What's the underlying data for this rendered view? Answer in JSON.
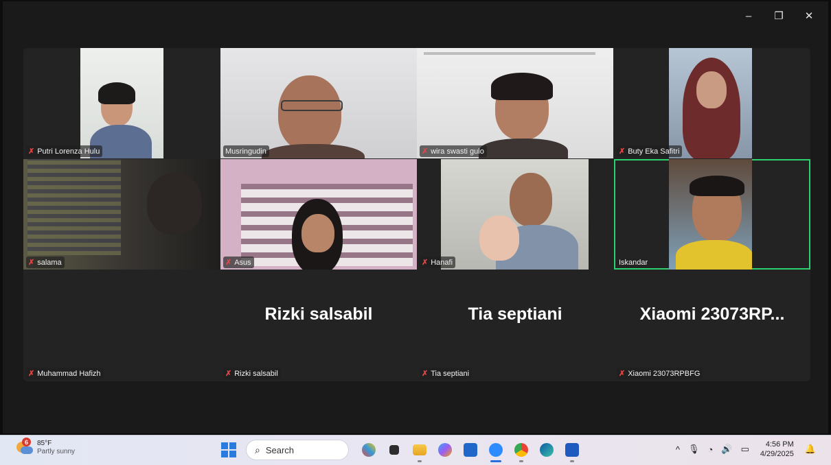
{
  "window": {
    "minimize": "–",
    "restore": "❐",
    "close": "✕"
  },
  "participants": [
    {
      "name": "Putri Lorenza Hulu",
      "muted": true
    },
    {
      "name": "Musringudin",
      "muted": false
    },
    {
      "name": "wira swasti gulo",
      "muted": true
    },
    {
      "name": "Buty Eka Safitri",
      "muted": true
    },
    {
      "name": "salama",
      "muted": true
    },
    {
      "name": "Asus",
      "muted": true
    },
    {
      "name": "Hanafi",
      "muted": true
    },
    {
      "name": "Iskandar",
      "muted": false,
      "active_speaker": true
    },
    {
      "name": "Muhammad Hafizh",
      "muted": true
    },
    {
      "name": "Rizki salsabil",
      "muted": true,
      "big": "Rizki salsabil"
    },
    {
      "name": "Tia septiani",
      "muted": true,
      "big": "Tia septiani"
    },
    {
      "name": "Xiaomi 23073RPBFG",
      "muted": true,
      "big": "Xiaomi  23073RP..."
    }
  ],
  "taskbar": {
    "weather": {
      "badge": "6",
      "temp": "85°F",
      "desc": "Partly sunny"
    },
    "search_placeholder": "Search",
    "apps": [
      "widgets-app",
      "file-explorer",
      "folder",
      "copilot",
      "mail",
      "zoom",
      "chrome",
      "edge",
      "word"
    ],
    "tray": {
      "chevron": "^",
      "time": "4:56 PM",
      "date": "4/29/2025"
    }
  },
  "colors": {
    "active_border": "#2bd26d",
    "mute_icon": "#e34545",
    "accent": "#2a7be0"
  }
}
